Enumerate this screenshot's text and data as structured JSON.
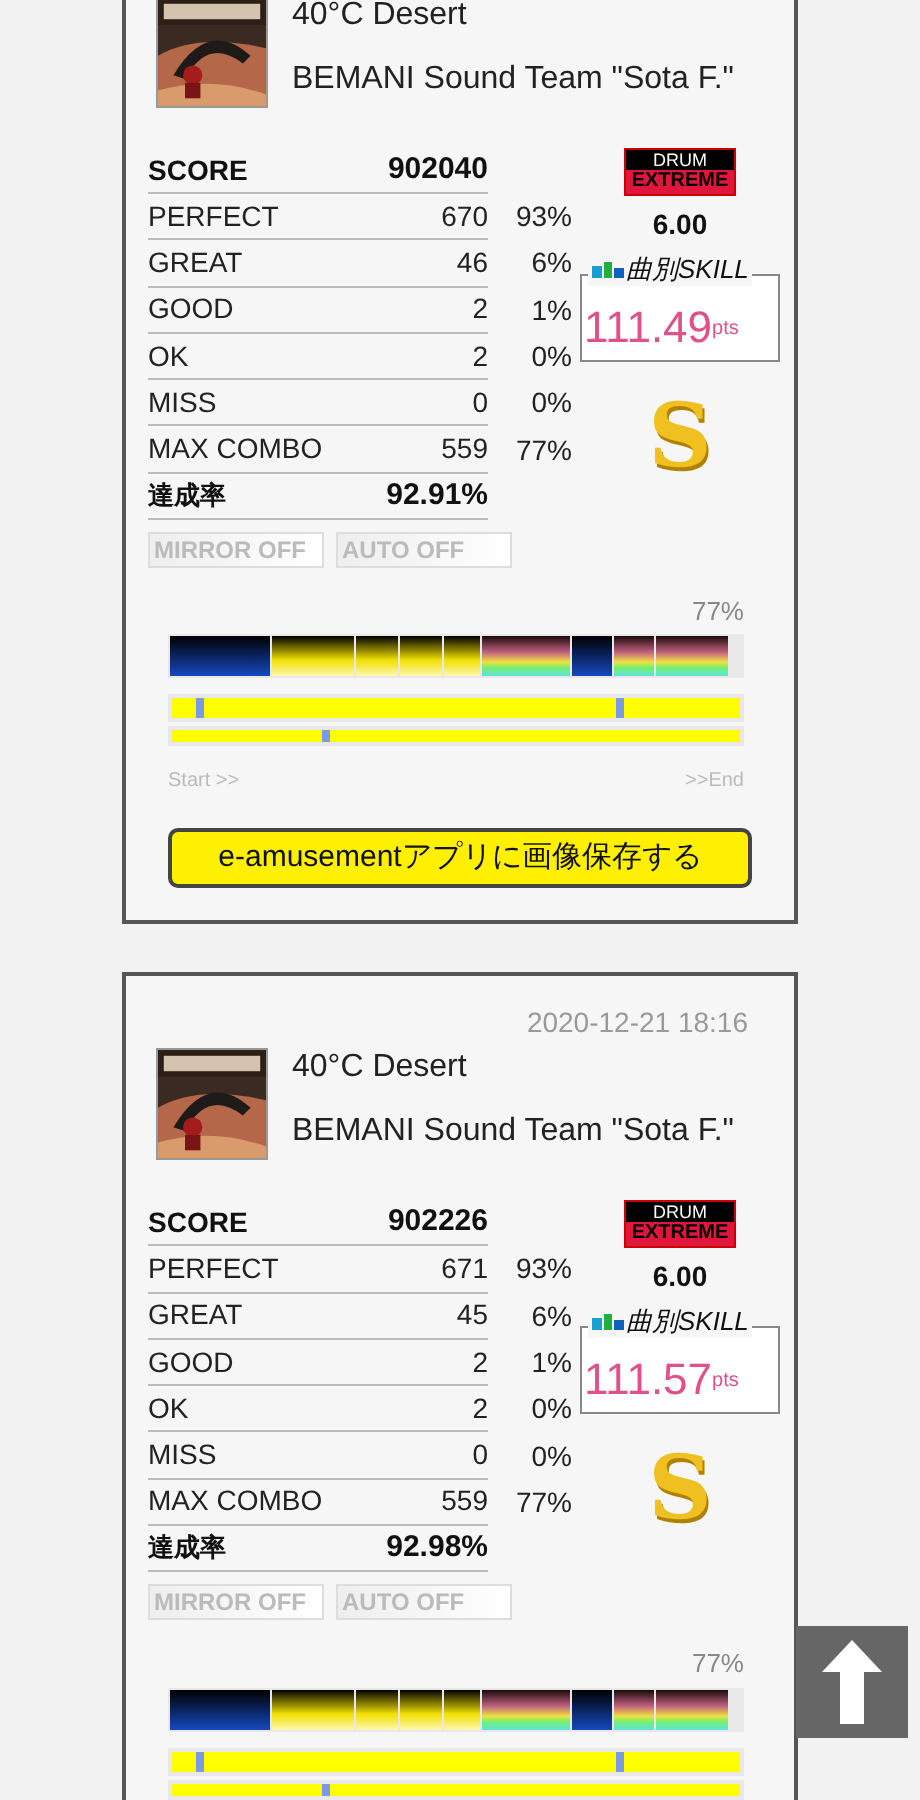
{
  "cards": [
    {
      "title": "40°C Desert",
      "artist": "BEMANI Sound Team \"Sota F.\"",
      "score_label": "SCORE",
      "score": "902040",
      "instrument": "DRUM",
      "difficulty": "EXTREME",
      "level": "6.00",
      "skill_label": "曲別SKILL",
      "skill": "111.49",
      "skill_unit": "pts",
      "rank": "S",
      "judgements": [
        {
          "label": "PERFECT",
          "count": "670",
          "percent": "93%"
        },
        {
          "label": "GREAT",
          "count": "46",
          "percent": "6%"
        },
        {
          "label": "GOOD",
          "count": "2",
          "percent": "1%"
        },
        {
          "label": "OK",
          "count": "2",
          "percent": "0%"
        },
        {
          "label": "MISS",
          "count": "0",
          "percent": "0%"
        },
        {
          "label": "MAX COMBO",
          "count": "559",
          "percent": "77%"
        }
      ],
      "rate_label": "達成率",
      "rate": "92.91%",
      "options": [
        "MIRROR OFF",
        "AUTO OFF"
      ],
      "gauge_percent": "77%",
      "start_label": "Start >>",
      "end_label": ">>End",
      "save_button": "e-amusementアプリに画像保存する"
    },
    {
      "date": "2020-12-21 18:16",
      "title": "40°C Desert",
      "artist": "BEMANI Sound Team \"Sota F.\"",
      "score_label": "SCORE",
      "score": "902226",
      "instrument": "DRUM",
      "difficulty": "EXTREME",
      "level": "6.00",
      "skill_label": "曲別SKILL",
      "skill": "111.57",
      "skill_unit": "pts",
      "rank": "S",
      "judgements": [
        {
          "label": "PERFECT",
          "count": "671",
          "percent": "93%"
        },
        {
          "label": "GREAT",
          "count": "45",
          "percent": "6%"
        },
        {
          "label": "GOOD",
          "count": "2",
          "percent": "1%"
        },
        {
          "label": "OK",
          "count": "2",
          "percent": "0%"
        },
        {
          "label": "MISS",
          "count": "0",
          "percent": "0%"
        },
        {
          "label": "MAX COMBO",
          "count": "559",
          "percent": "77%"
        }
      ],
      "rate_label": "達成率",
      "rate": "92.98%",
      "options": [
        "MIRROR OFF",
        "AUTO OFF"
      ],
      "gauge_percent": "77%"
    }
  ]
}
